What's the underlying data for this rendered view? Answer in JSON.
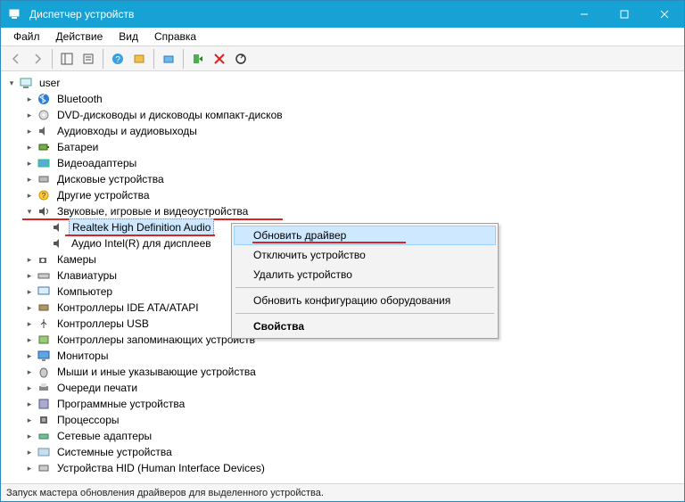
{
  "window": {
    "title": "Диспетчер устройств"
  },
  "menu": {
    "file": "Файл",
    "action": "Действие",
    "view": "Вид",
    "help": "Справка"
  },
  "tree": {
    "root": "user",
    "items": [
      {
        "label": "Bluetooth"
      },
      {
        "label": "DVD-дисководы и дисководы компакт-дисков"
      },
      {
        "label": "Аудиовходы и аудиовыходы"
      },
      {
        "label": "Батареи"
      },
      {
        "label": "Видеоадаптеры"
      },
      {
        "label": "Дисковые устройства"
      },
      {
        "label": "Другие устройства"
      },
      {
        "label": "Звуковые, игровые и видеоустройства"
      },
      {
        "label": "Камеры"
      },
      {
        "label": "Клавиатуры"
      },
      {
        "label": "Компьютер"
      },
      {
        "label": "Контроллеры IDE ATA/ATAPI"
      },
      {
        "label": "Контроллеры USB"
      },
      {
        "label": "Контроллеры запоминающих устройств"
      },
      {
        "label": "Мониторы"
      },
      {
        "label": "Мыши и иные указывающие устройства"
      },
      {
        "label": "Очереди печати"
      },
      {
        "label": "Программные устройства"
      },
      {
        "label": "Процессоры"
      },
      {
        "label": "Сетевые адаптеры"
      },
      {
        "label": "Системные устройства"
      },
      {
        "label": "Устройства HID (Human Interface Devices)"
      }
    ],
    "sound_children": {
      "sel": "Realtek High Definition Audio",
      "other": "Аудио Intel(R) для дисплеев"
    }
  },
  "context": {
    "update": "Обновить драйвер",
    "disable": "Отключить устройство",
    "uninstall": "Удалить устройство",
    "scan": "Обновить конфигурацию оборудования",
    "props": "Свойства"
  },
  "status": "Запуск мастера обновления драйверов для выделенного устройства."
}
